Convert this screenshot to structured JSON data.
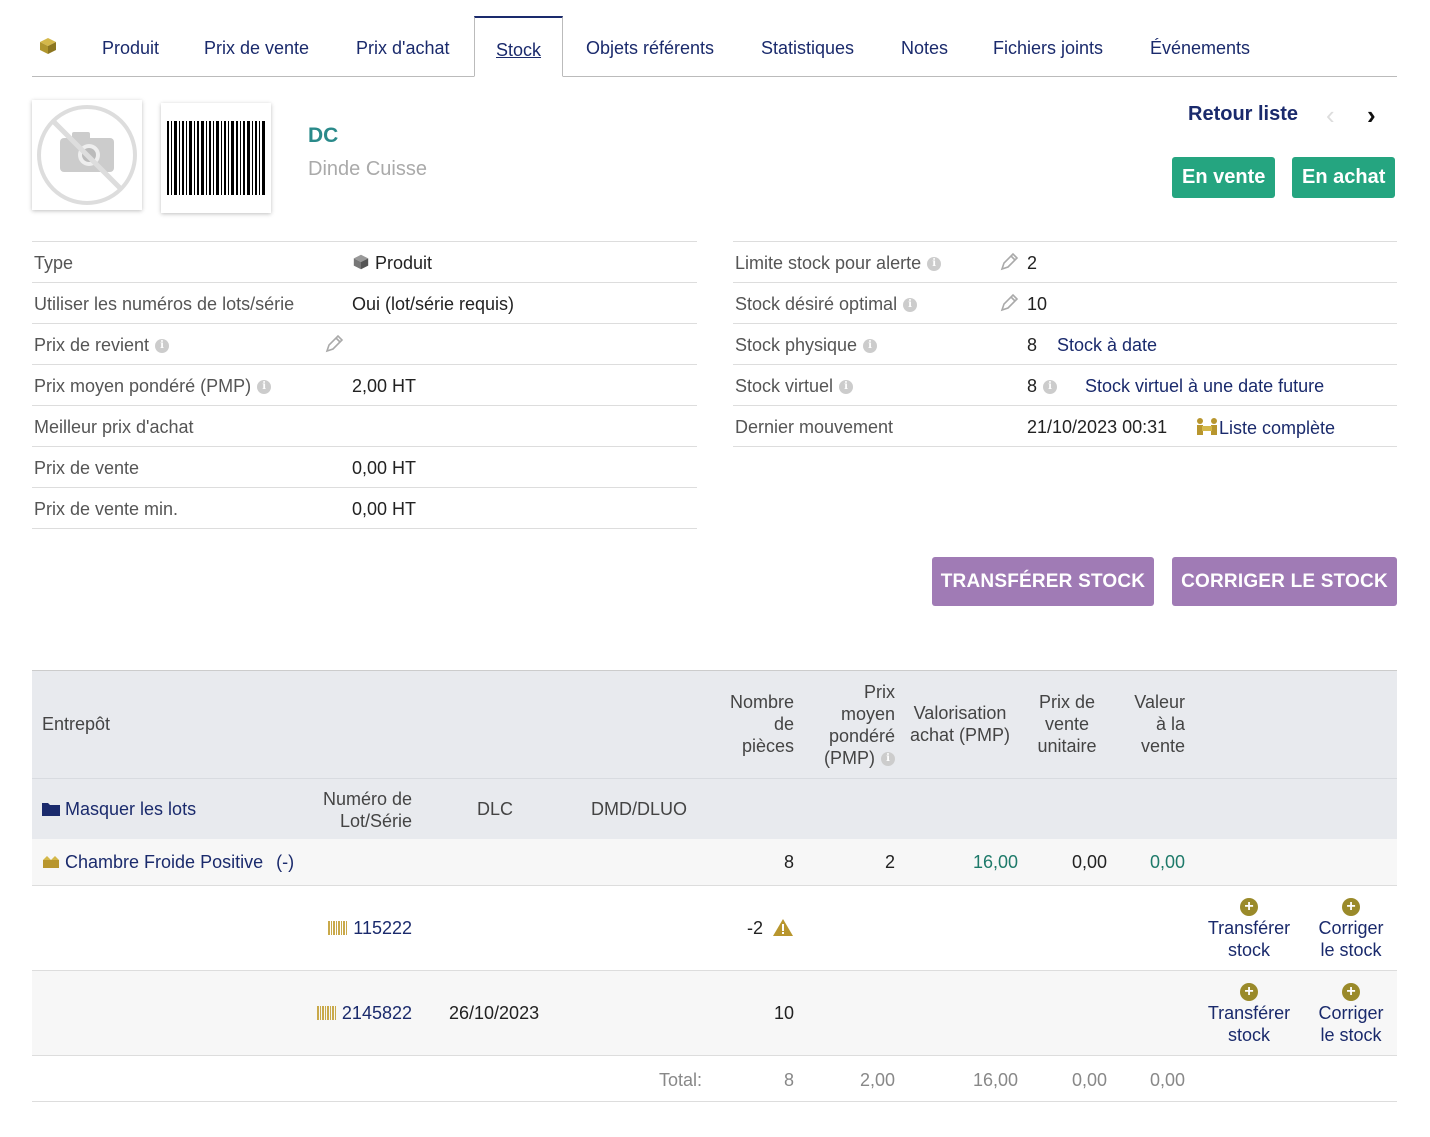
{
  "tabs": [
    {
      "label": "Produit"
    },
    {
      "label": "Prix de vente"
    },
    {
      "label": "Prix d'achat"
    },
    {
      "label": "Stock"
    },
    {
      "label": "Objets référents"
    },
    {
      "label": "Statistiques"
    },
    {
      "label": "Notes"
    },
    {
      "label": "Fichiers joints"
    },
    {
      "label": "Événements"
    }
  ],
  "product": {
    "ref": "DC",
    "label": "Dinde Cuisse"
  },
  "header": {
    "back": "Retour liste",
    "prev": "‹",
    "next": "›",
    "badge_sell": "En vente",
    "badge_buy": "En achat"
  },
  "left_info": [
    {
      "key": "Type",
      "value": "Produit"
    },
    {
      "key": "Utiliser les numéros de lots/série",
      "value": "Oui (lot/série requis)"
    },
    {
      "key": "Prix de revient",
      "value": ""
    },
    {
      "key": "Prix moyen pondéré (PMP)",
      "value": "2,00 HT"
    },
    {
      "key": "Meilleur prix d'achat",
      "value": ""
    },
    {
      "key": "Prix de vente",
      "value": "0,00 HT"
    },
    {
      "key": "Prix de vente min.",
      "value": "0,00 HT"
    }
  ],
  "right_info": [
    {
      "key": "Limite stock pour alerte",
      "value": "2"
    },
    {
      "key": "Stock désiré optimal",
      "value": "10"
    },
    {
      "key": "Stock physique",
      "value": "8",
      "link": "Stock à date"
    },
    {
      "key": "Stock virtuel",
      "value": "8",
      "link": "Stock virtuel à une date future"
    },
    {
      "key": "Dernier mouvement",
      "value": "21/10/2023 00:31",
      "link": "Liste complète"
    }
  ],
  "buttons": {
    "transfer": "TRANSFÉRER STOCK",
    "correct": "CORRIGER LE STOCK"
  },
  "table": {
    "headers": {
      "warehouse": "Entrepôt",
      "pieces": [
        "Nombre",
        "de",
        "pièces"
      ],
      "pmp": [
        "Prix",
        "moyen",
        "pondéré",
        "(PMP)"
      ],
      "valuation": [
        "Valorisation",
        "achat (PMP)"
      ],
      "unit_price": [
        "Prix de",
        "vente",
        "unitaire"
      ],
      "sale_value": [
        "Valeur",
        "à la",
        "vente"
      ],
      "hide_lots": "Masquer les lots",
      "lot_number": [
        "Numéro de",
        "Lot/Série"
      ],
      "dlc": "DLC",
      "dmd": "DMD/DLUO"
    },
    "warehouse": {
      "name": "Chambre Froide Positive",
      "suffix": "(-)",
      "pieces": "8",
      "pmp": "2",
      "valuation": "16,00",
      "unit_price": "0,00",
      "sale_value": "0,00"
    },
    "lots": [
      {
        "number": "115222",
        "dlc": "",
        "qty": "-2",
        "transfer": [
          "Transférer",
          "stock"
        ],
        "correct": [
          "Corriger",
          "le stock"
        ]
      },
      {
        "number": "2145822",
        "dlc": "26/10/2023",
        "qty": "10",
        "transfer": [
          "Transférer",
          "stock"
        ],
        "correct": [
          "Corriger",
          "le stock"
        ]
      }
    ],
    "total": {
      "label": "Total:",
      "pieces": "8",
      "pmp": "2,00",
      "valuation": "16,00",
      "unit_price": "0,00",
      "sale_value": "0,00"
    }
  },
  "icons": {
    "product_tab": "cube-icon",
    "info": "info-icon",
    "edit": "pencil-icon",
    "folder": "folder-icon",
    "warehouse": "boxes-icon",
    "barcode": "barcode-icon",
    "warning": "warning-icon",
    "add": "plus-circle-icon",
    "movements": "people-icon"
  }
}
